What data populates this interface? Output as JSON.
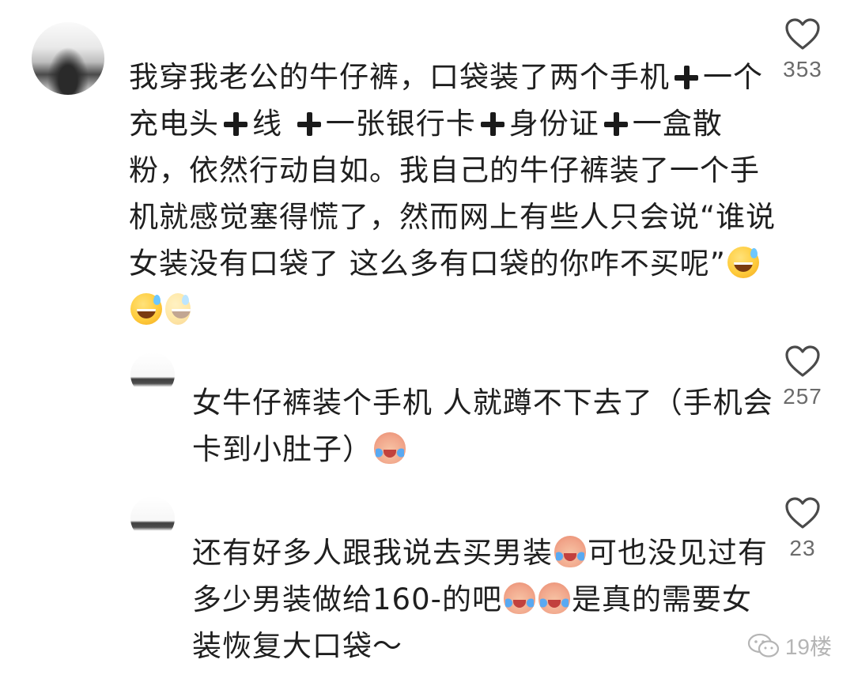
{
  "comments": [
    {
      "lines": [
        [
          "我穿我老公的牛仔裤，口袋装了两个手机",
          "plus",
          "一个"
        ],
        [
          "充电头",
          "plus",
          "线",
          "plus",
          "一张银行卡",
          "plus",
          "身份证",
          "plus",
          "一盒散"
        ],
        [
          "粉，依然行动自如。我自己的牛仔裤装了一个手"
        ],
        [
          "机就感觉塞得慌了，然而网上有些人只会说“谁说"
        ],
        [
          "女装没有口袋了 这么多有口袋的你咋不买呢”",
          "emoji:grinning-sweat"
        ],
        [
          "emoji:grinning-sweat",
          "emoji:grinning-sweat-faded"
        ]
      ],
      "likes": "353"
    },
    {
      "lines": [
        [
          "女牛仔裤装个手机 人就蹲不下去了（手机会"
        ],
        [
          "卡到小肚子）",
          "emoji:crying-peach"
        ]
      ],
      "likes": "257"
    },
    {
      "lines": [
        [
          "还有好多人跟我说去买男装",
          "emoji:crying-peach",
          "可也没见过有"
        ],
        [
          "多少男装做给160-的吧",
          "emoji:crying-peach",
          "emoji:crying-peach",
          "是真的需要女"
        ],
        [
          "装恢复大口袋～"
        ]
      ],
      "likes": "23"
    }
  ],
  "icons": {
    "like": "heart-outline-icon",
    "watermark": "wechat-icon"
  },
  "watermark": {
    "text": "19楼"
  },
  "colors": {
    "text": "#1f1f1f",
    "count": "#6b6b6b",
    "watermark": "#b5b5b5"
  }
}
